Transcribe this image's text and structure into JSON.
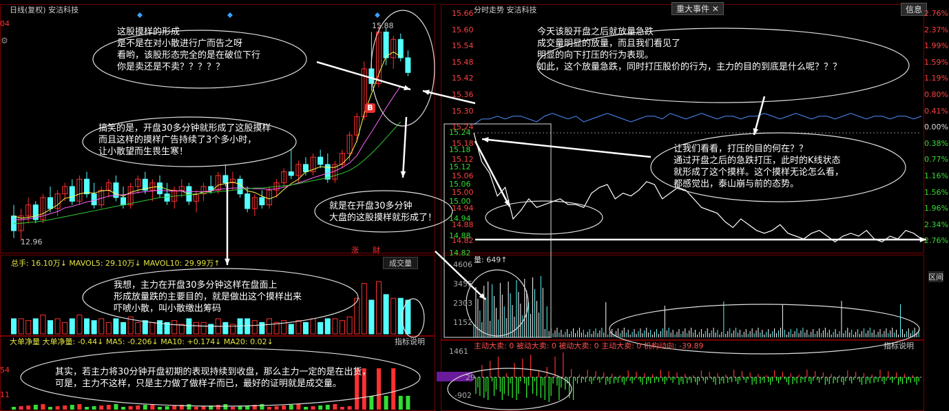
{
  "colors": {
    "up": "#ff3030",
    "down": "#54ffff",
    "yellow": "#ffff55",
    "grid": "#7a0000",
    "ma_pink": "#ff66ff",
    "ma_green": "#33cc33",
    "white": "#ffffff",
    "purple": "#6a1b9a"
  },
  "left": {
    "header": "日线(复权)  安洁科技",
    "axis_top": "04",
    "gear_icon": "gear",
    "high_label": "15.88",
    "low_label": "12.96",
    "marker_b": "B",
    "tag_zhang": "涨",
    "tag_cai": "财",
    "vol_header": "总手: 16.10万↓  MAVOL5: 29.10万↓  MAVOL10: 29.99万↑",
    "vol_button": "成交量",
    "bigorder_header": "大单净量  大单净量: -0.44↓  MA5: -0.206↓  MA10: +0.174↓  MA20: 0.02↓",
    "indicator_btn": "指标说明",
    "side_labels": [
      "54",
      "11"
    ]
  },
  "right": {
    "header": "分时走势  安洁科技",
    "tab_event": "重大事件",
    "tab_close": "✕",
    "info_btn": "信息",
    "price_axis": [
      "15.66",
      "15.60",
      "15.54",
      "15.48",
      "15.42",
      "15.36",
      "15.30",
      "15.24",
      "15.18",
      "15.12",
      "15.06",
      "15.00",
      "14.94",
      "14.88",
      "14.82"
    ],
    "pct_axis": [
      "2.76%",
      "2.37%",
      "1.99%",
      "1.59%",
      "1.19%",
      "0.80%",
      "0.41%",
      "0.00%",
      "0.38%",
      "0.77%",
      "1.16%",
      "1.56%",
      "1.96%",
      "2.34%",
      "2.76%"
    ],
    "inset_axis": [
      "15.24",
      "15.18",
      "15.12",
      "15.06",
      "15.00",
      "14.94",
      "14.88",
      "14.82"
    ],
    "vol_label": "量: 649↑",
    "vol_axis": [
      "4606",
      "3455",
      "2303",
      "1152"
    ],
    "qujian": "区间",
    "flow_header": "主动大卖: 0  被动大卖: 0  被动大卖: 0  主动大卖: 0  机构动向: -39.89",
    "flow_axis": [
      "1461",
      "29",
      "-902"
    ],
    "indicator_btn": "指标说明"
  },
  "notes": {
    "n1": "这股摸样的形成\n是不是在对小散进行广而告之呀\n看哟，该股形态完全的是在破位下行\n你是卖还是不卖？？？？？",
    "n2": "搞笑的是，开盘30多分钟就形成了这股摸样\n而且这样的摸样广告持续了3个多小时，\n让小散望而生畏生寒！",
    "n3": "就是在开盘30多分钟\n大盘的这股摸样就形成了！",
    "n4": "我想，主力在开盘30多分钟这样在盘面上\n形成放量跌的主要目的，就是做出这个摸样出来\n吓唬小散，叫小散缴出筹码",
    "n5": "其实，若主力将30分钟开盘初期的表现持续到收盘，那么主力一定的是在出货，\n可是，主力不这样，只是主力做了做样子而已，最好的证明就是成交量。",
    "n6": "今天该股开盘之后就放量急跌\n成交量明显的放量，而且我们看见了\n明显的向下打压的行为表现。\n如此，这个放量急跌，同时打压股价的行为，主力的目的到底是什么呢？？？",
    "n7": "让我们看看，打压的目的何在？？\n通过开盘之后的急跌打压，此时的K线状态\n就形成了这个摸样。这个摸样无论怎么看，\n都感觉出，泰山崩与前的态势。"
  },
  "chart_data": [
    {
      "type": "candlestick",
      "title": "日线(复权) 安洁科技",
      "high_marker": 15.88,
      "low_marker": 12.96,
      "candles": [
        {
          "o": 13.3,
          "h": 13.45,
          "l": 13.0,
          "c": 13.1
        },
        {
          "o": 13.1,
          "h": 13.4,
          "l": 12.96,
          "c": 13.3
        },
        {
          "o": 13.3,
          "h": 13.55,
          "l": 13.2,
          "c": 13.45
        },
        {
          "o": 13.45,
          "h": 13.5,
          "l": 13.2,
          "c": 13.25
        },
        {
          "o": 13.25,
          "h": 13.6,
          "l": 13.2,
          "c": 13.55
        },
        {
          "o": 13.55,
          "h": 13.7,
          "l": 13.35,
          "c": 13.4
        },
        {
          "o": 13.4,
          "h": 13.65,
          "l": 13.3,
          "c": 13.6
        },
        {
          "o": 13.6,
          "h": 13.75,
          "l": 13.5,
          "c": 13.7
        },
        {
          "o": 13.7,
          "h": 13.8,
          "l": 13.45,
          "c": 13.5
        },
        {
          "o": 13.5,
          "h": 13.85,
          "l": 13.45,
          "c": 13.8
        },
        {
          "o": 13.8,
          "h": 13.9,
          "l": 13.55,
          "c": 13.6
        },
        {
          "o": 13.6,
          "h": 13.75,
          "l": 13.4,
          "c": 13.45
        },
        {
          "o": 13.45,
          "h": 13.7,
          "l": 13.4,
          "c": 13.65
        },
        {
          "o": 13.65,
          "h": 13.8,
          "l": 13.55,
          "c": 13.75
        },
        {
          "o": 13.75,
          "h": 13.85,
          "l": 13.5,
          "c": 13.55
        },
        {
          "o": 13.55,
          "h": 13.7,
          "l": 13.4,
          "c": 13.45
        },
        {
          "o": 13.45,
          "h": 13.75,
          "l": 13.4,
          "c": 13.7
        },
        {
          "o": 13.7,
          "h": 13.85,
          "l": 13.6,
          "c": 13.8
        },
        {
          "o": 13.8,
          "h": 13.9,
          "l": 13.6,
          "c": 13.65
        },
        {
          "o": 13.65,
          "h": 13.8,
          "l": 13.5,
          "c": 13.75
        },
        {
          "o": 13.75,
          "h": 13.85,
          "l": 13.55,
          "c": 13.6
        },
        {
          "o": 13.6,
          "h": 13.75,
          "l": 13.45,
          "c": 13.5
        },
        {
          "o": 13.5,
          "h": 13.7,
          "l": 13.4,
          "c": 13.65
        },
        {
          "o": 13.65,
          "h": 13.8,
          "l": 13.55,
          "c": 13.7
        },
        {
          "o": 13.7,
          "h": 13.75,
          "l": 13.45,
          "c": 13.5
        },
        {
          "o": 13.5,
          "h": 13.65,
          "l": 13.35,
          "c": 13.6
        },
        {
          "o": 13.6,
          "h": 13.75,
          "l": 13.5,
          "c": 13.7
        },
        {
          "o": 13.7,
          "h": 13.85,
          "l": 13.6,
          "c": 13.65
        },
        {
          "o": 13.65,
          "h": 13.9,
          "l": 13.6,
          "c": 13.85
        },
        {
          "o": 13.85,
          "h": 14.0,
          "l": 13.7,
          "c": 13.75
        },
        {
          "o": 13.75,
          "h": 13.9,
          "l": 13.65,
          "c": 13.8
        },
        {
          "o": 13.8,
          "h": 13.85,
          "l": 13.55,
          "c": 13.6
        },
        {
          "o": 13.6,
          "h": 13.7,
          "l": 13.35,
          "c": 13.4
        },
        {
          "o": 13.4,
          "h": 13.6,
          "l": 13.3,
          "c": 13.55
        },
        {
          "o": 13.55,
          "h": 13.65,
          "l": 13.4,
          "c": 13.45
        },
        {
          "o": 13.45,
          "h": 13.7,
          "l": 13.4,
          "c": 13.65
        },
        {
          "o": 13.65,
          "h": 13.8,
          "l": 13.55,
          "c": 13.75
        },
        {
          "o": 13.75,
          "h": 13.95,
          "l": 13.7,
          "c": 13.9
        },
        {
          "o": 13.9,
          "h": 14.2,
          "l": 13.8,
          "c": 13.85
        },
        {
          "o": 13.85,
          "h": 14.05,
          "l": 13.75,
          "c": 14.0
        },
        {
          "o": 14.0,
          "h": 14.1,
          "l": 13.85,
          "c": 13.9
        },
        {
          "o": 13.9,
          "h": 14.15,
          "l": 13.85,
          "c": 14.1
        },
        {
          "o": 14.1,
          "h": 14.2,
          "l": 13.95,
          "c": 14.0
        },
        {
          "o": 14.0,
          "h": 14.15,
          "l": 13.75,
          "c": 13.8
        },
        {
          "o": 13.8,
          "h": 14.05,
          "l": 13.75,
          "c": 14.0
        },
        {
          "o": 14.0,
          "h": 14.2,
          "l": 13.95,
          "c": 14.15
        },
        {
          "o": 14.15,
          "h": 14.45,
          "l": 14.05,
          "c": 14.4
        },
        {
          "o": 14.4,
          "h": 14.7,
          "l": 14.3,
          "c": 14.65
        },
        {
          "o": 14.65,
          "h": 15.4,
          "l": 14.6,
          "c": 15.3
        },
        {
          "o": 15.3,
          "h": 15.8,
          "l": 15.0,
          "c": 15.1
        },
        {
          "o": 15.1,
          "h": 15.88,
          "l": 15.05,
          "c": 15.8
        },
        {
          "o": 15.8,
          "h": 15.85,
          "l": 15.35,
          "c": 15.45
        },
        {
          "o": 15.45,
          "h": 15.75,
          "l": 15.3,
          "c": 15.7
        },
        {
          "o": 15.7,
          "h": 15.78,
          "l": 15.4,
          "c": 15.45
        },
        {
          "o": 15.45,
          "h": 15.55,
          "l": 15.2,
          "c": 15.25
        }
      ],
      "moving_averages": [
        {
          "name": "MA5",
          "color": "#ffff55",
          "values": [
            13.3,
            13.27,
            13.28,
            13.3,
            13.33,
            13.39,
            13.45,
            13.54,
            13.56,
            13.6,
            13.62,
            13.61,
            13.64,
            13.65,
            13.6,
            13.57,
            13.62,
            13.65,
            13.67,
            13.69,
            13.7,
            13.66,
            13.64,
            13.64,
            13.59,
            13.59,
            13.63,
            13.63,
            13.72,
            13.74,
            13.76,
            13.73,
            13.64,
            13.62,
            13.57,
            13.53,
            13.57,
            13.66,
            13.74,
            13.8,
            13.9,
            13.93,
            13.97,
            13.96,
            13.96,
            14.01,
            14.11,
            14.32,
            14.69,
            14.96,
            15.23,
            15.47,
            15.53,
            15.47
          ]
        },
        {
          "name": "MA10",
          "color": "#ff66ff",
          "values": [
            13.25,
            13.25,
            13.26,
            13.28,
            13.3,
            13.33,
            13.36,
            13.41,
            13.43,
            13.46,
            13.49,
            13.51,
            13.54,
            13.57,
            13.58,
            13.59,
            13.6,
            13.62,
            13.63,
            13.64,
            13.65,
            13.64,
            13.64,
            13.64,
            13.63,
            13.63,
            13.63,
            13.64,
            13.66,
            13.67,
            13.68,
            13.68,
            13.68,
            13.67,
            13.67,
            13.66,
            13.67,
            13.69,
            13.72,
            13.75,
            13.78,
            13.82,
            13.85,
            13.88,
            13.91,
            13.96,
            14.02,
            14.12,
            14.29,
            14.44,
            14.6,
            14.77,
            14.92,
            15.07
          ]
        },
        {
          "name": "MA20",
          "color": "#33cc33",
          "values": [
            13.2,
            13.2,
            13.21,
            13.22,
            13.23,
            13.25,
            13.27,
            13.29,
            13.31,
            13.33,
            13.35,
            13.37,
            13.39,
            13.41,
            13.43,
            13.45,
            13.47,
            13.49,
            13.51,
            13.53,
            13.55,
            13.56,
            13.57,
            13.58,
            13.59,
            13.6,
            13.61,
            13.62,
            13.63,
            13.64,
            13.65,
            13.66,
            13.67,
            13.68,
            13.68,
            13.69,
            13.7,
            13.71,
            13.72,
            13.74,
            13.76,
            13.78,
            13.8,
            13.82,
            13.85,
            13.88,
            13.92,
            13.98,
            14.06,
            14.15,
            14.25,
            14.36,
            14.47,
            14.58
          ]
        }
      ],
      "volume_series": {
        "name": "成交量",
        "mavol5": "29.10万",
        "mavol10": "29.99万",
        "total": "16.10万"
      }
    },
    {
      "type": "line",
      "title": "分时走势 安洁科技",
      "ylim": [
        14.82,
        15.66
      ],
      "prev_close_pct_axis": "0.00%",
      "series": [
        {
          "name": "price",
          "values": [
            15.24,
            15.14,
            15.1,
            15.02,
            15.05,
            14.94,
            14.97,
            15.01,
            14.98,
            14.99,
            15.0,
            15.01,
            14.99,
            14.99,
            14.98,
            15.03,
            15.05,
            15.06,
            15.01,
            15.03,
            15.02,
            15.04,
            15.07,
            15.06,
            15.01,
            15.03,
            15.05,
            15.04,
            15.01,
            14.98,
            14.97,
            14.96,
            14.93,
            14.91,
            14.94,
            14.92,
            14.9,
            14.89,
            14.9,
            14.92,
            14.89,
            14.88,
            14.87,
            14.89,
            14.9,
            14.88,
            14.86,
            14.88,
            14.89,
            14.88,
            14.9,
            14.87,
            14.86,
            14.88,
            14.87,
            14.9,
            14.89,
            14.87
          ]
        },
        {
          "name": "index",
          "values": [
            15.28,
            15.3,
            15.3,
            15.31,
            15.3,
            15.31,
            15.31,
            15.3,
            15.29,
            15.31,
            15.32,
            15.31,
            15.3,
            15.31,
            15.29,
            15.3,
            15.31,
            15.32,
            15.31,
            15.3,
            15.29,
            15.3,
            15.31,
            15.31,
            15.3,
            15.32,
            15.31,
            15.3,
            15.31,
            15.32,
            15.31,
            15.3,
            15.31,
            15.31,
            15.3,
            15.31,
            15.31,
            15.32,
            15.31,
            15.3,
            15.31,
            15.32,
            15.31,
            15.3,
            15.31,
            15.31,
            15.3,
            15.31,
            15.32,
            15.31,
            15.3,
            15.31,
            15.31,
            15.3,
            15.31,
            15.31,
            15.3,
            15.31
          ]
        }
      ]
    }
  ]
}
